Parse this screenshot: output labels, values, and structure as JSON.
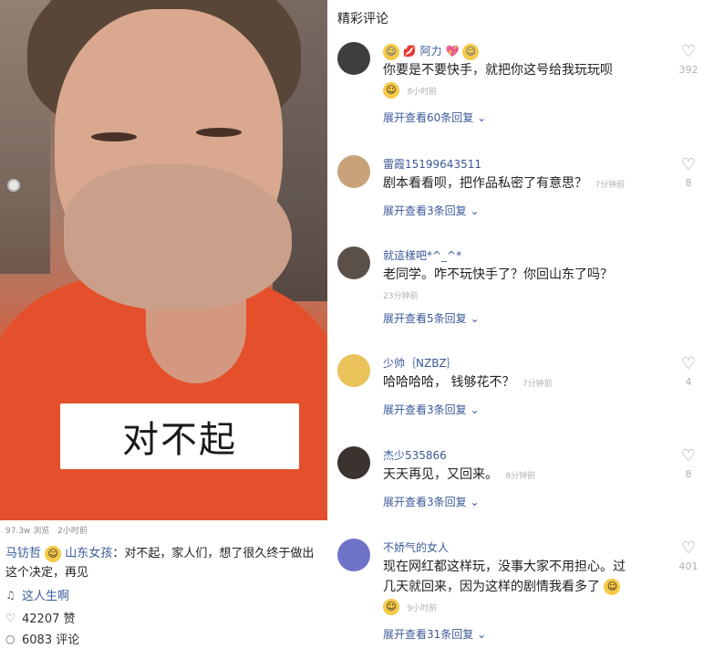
{
  "left": {
    "caption_overlay": "对不起",
    "views": "97.3w 浏览",
    "time": "2小时前",
    "author": "马钫哲",
    "mention": "山东女孩",
    "description": "：对不起，家人们，想了很久终于做出这个决定，再见",
    "song": "这人生啊",
    "likes": "42207 赞",
    "comments": "6083 评论"
  },
  "right": {
    "title": "精彩评论",
    "comments": [
      {
        "user": "阿力",
        "text": "你要是不要快手，就把你这号给我玩玩呗",
        "time": "8小时前",
        "expand": "展开查看60条回复",
        "likes": "392",
        "avatar_color": "#4a4a4a"
      },
      {
        "user": "雷霞15199643511",
        "text": "剧本看看呗，把作品私密了有意思？",
        "time": "7分钟前",
        "expand": "展开查看3条回复",
        "likes": "8",
        "avatar_color": "#c9a27a"
      },
      {
        "user": "就這樣吧*^_^*",
        "text": "老同学。咋不玩快手了？你回山东了吗？",
        "time": "23分钟前",
        "expand": "展开查看5条回复",
        "likes": "",
        "avatar_color": "#5b5048"
      },
      {
        "user": "少帅｛NZBZ｝",
        "text": "哈哈哈哈， 钱够花不？",
        "time": "7分钟前",
        "expand": "展开查看3条回复",
        "likes": "4",
        "avatar_color": "#e9c25a"
      },
      {
        "user": "杰少535866",
        "text": "天天再见，又回来。",
        "time": "8分钟前",
        "expand": "展开查看3条回复",
        "likes": "8",
        "avatar_color": "#3a3330"
      },
      {
        "user": "不娇气的女人",
        "text_line1": "现在网红都这样玩，没事大家不用担心。过",
        "text_line2": "几天就回来，因为这样的剧情我看多了",
        "time": "9小时前",
        "expand": "展开查看31条回复",
        "likes": "401",
        "avatar_color": "#6f73c8"
      }
    ]
  },
  "icons": {
    "heart": "heart-outline-icon",
    "chevron": "chevron-down-icon",
    "music": "music-note-icon",
    "like": "like-heart-icon",
    "comment": "comment-bubble-icon"
  }
}
